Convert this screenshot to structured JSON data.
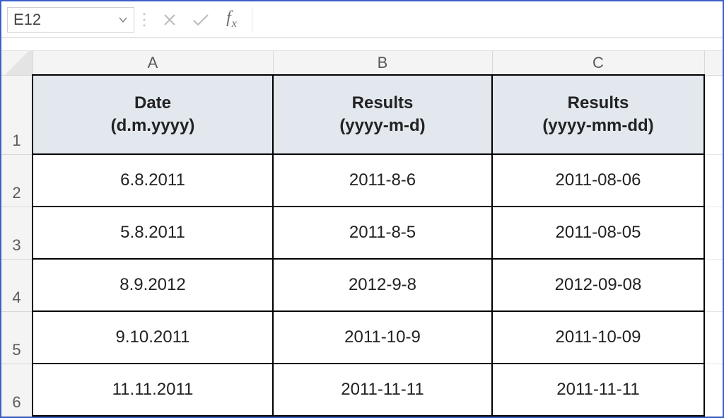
{
  "nameBox": {
    "value": "E12"
  },
  "formulaBar": {
    "fxLabel": "fx",
    "value": ""
  },
  "columns": {
    "A": "A",
    "B": "B",
    "C": "C"
  },
  "rowNumbers": [
    "1",
    "2",
    "3",
    "4",
    "5",
    "6"
  ],
  "sheetHeader": {
    "A": {
      "line1": "Date",
      "line2": "(d.m.yyyy)"
    },
    "B": {
      "line1": "Results",
      "line2": "(yyyy-m-d)"
    },
    "C": {
      "line1": "Results",
      "line2": "(yyyy-mm-dd)"
    }
  },
  "rows": [
    {
      "A": "6.8.2011",
      "B": "2011-8-6",
      "C": "2011-08-06"
    },
    {
      "A": "5.8.2011",
      "B": "2011-8-5",
      "C": "2011-08-05"
    },
    {
      "A": "8.9.2012",
      "B": "2012-9-8",
      "C": "2012-09-08"
    },
    {
      "A": "9.10.2011",
      "B": "2011-10-9",
      "C": "2011-10-09"
    },
    {
      "A": "11.11.2011",
      "B": "2011-11-11",
      "C": "2011-11-11"
    }
  ]
}
